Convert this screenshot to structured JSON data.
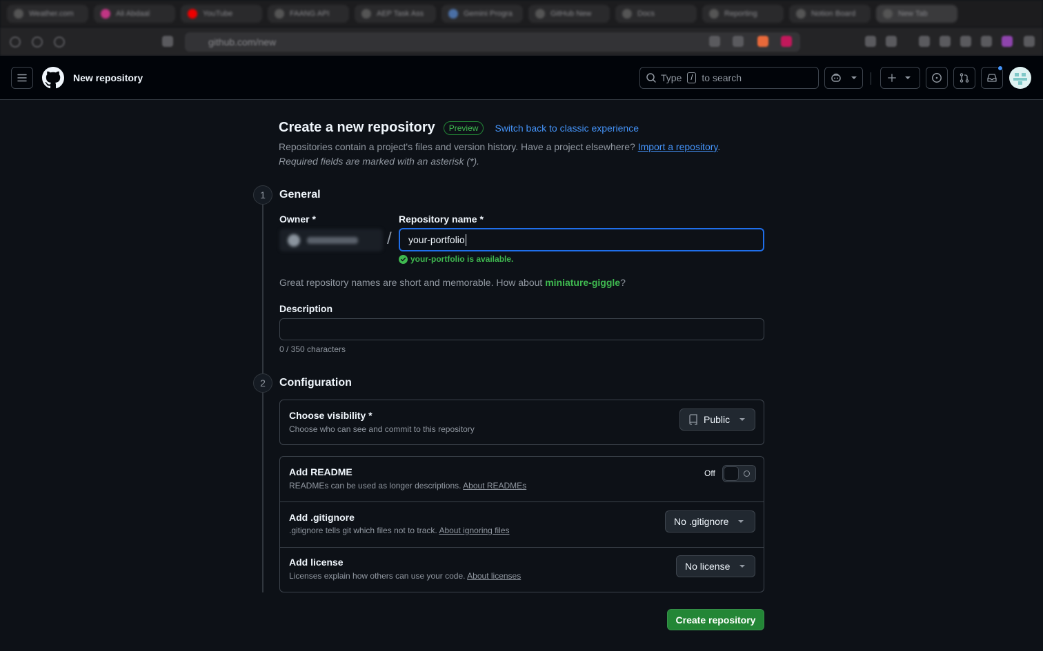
{
  "browser": {
    "tabs": [
      "Weather.com",
      "Ali Abdaal",
      "YouTube",
      "FAANG API",
      "AEP Task Ass",
      "Gemini Progra",
      "GitHub New",
      "Docs",
      "Reporting",
      "Notion Board",
      "New Tab"
    ],
    "url": "github.com/new"
  },
  "header": {
    "context_title": "New repository",
    "search_prefix": "Type",
    "search_key": "/",
    "search_suffix": "to search"
  },
  "page": {
    "title": "Create a new repository",
    "badge": "Preview",
    "switch_link": "Switch back to classic experience",
    "intro_text": "Repositories contain a project's files and version history. Have a project elsewhere?",
    "import_link": "Import a repository",
    "intro_end": ".",
    "required_note": "Required fields are marked with an asterisk (*)."
  },
  "general": {
    "step": "1",
    "title": "General",
    "owner_label": "Owner *",
    "slash": "/",
    "repo_name_label": "Repository name *",
    "repo_name_value": "your-portfolio",
    "availability": "your-portfolio is available.",
    "suggest_prefix": "Great repository names are short and memorable. How about ",
    "suggest_name": "miniature-giggle",
    "suggest_suffix": "?",
    "description_label": "Description",
    "description_value": "",
    "char_count": "0 / 350 characters"
  },
  "configuration": {
    "step": "2",
    "title": "Configuration",
    "visibility": {
      "title": "Choose visibility *",
      "desc": "Choose who can see and commit to this repository",
      "value": "Public"
    },
    "readme": {
      "title": "Add README",
      "desc": "READMEs can be used as longer descriptions.",
      "link": "About READMEs",
      "toggle_label": "Off"
    },
    "gitignore": {
      "title": "Add .gitignore",
      "desc": ".gitignore tells git which files not to track.",
      "link": "About ignoring files",
      "value": "No .gitignore"
    },
    "license": {
      "title": "Add license",
      "desc": "Licenses explain how others can use your code.",
      "link": "About licenses",
      "value": "No license"
    }
  },
  "actions": {
    "create": "Create repository"
  },
  "colors": {
    "background": "#0d1117",
    "accent_blue": "#4493f8",
    "success_green": "#3fb950",
    "primary_button": "#238636"
  }
}
